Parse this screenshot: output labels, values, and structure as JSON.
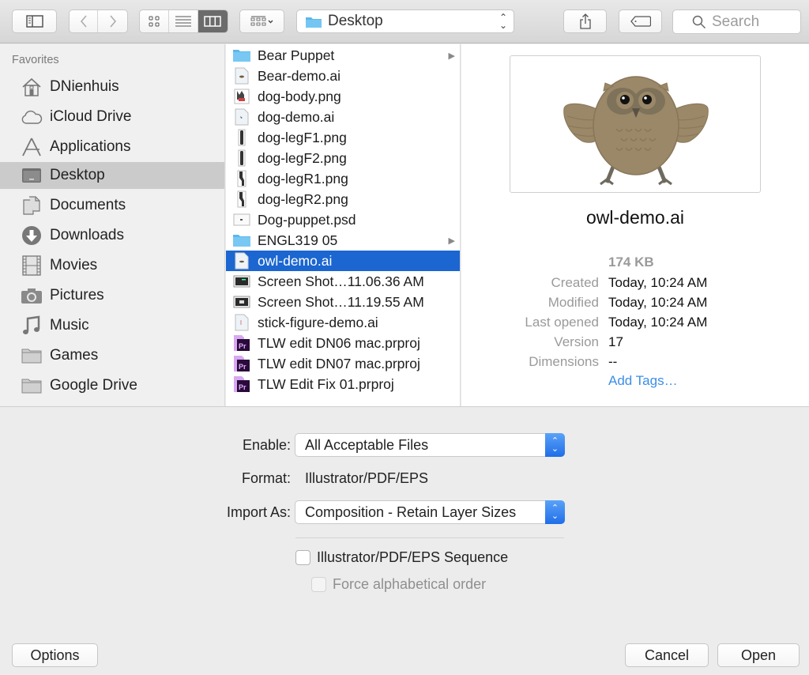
{
  "toolbar": {
    "sidebar_toggle_icon": "sidebar-icon",
    "back_icon": "chevron-left-icon",
    "forward_icon": "chevron-right-icon",
    "view_modes": [
      {
        "name": "icon-view",
        "icon": "grid-icon",
        "active": false
      },
      {
        "name": "list-view",
        "icon": "list-icon",
        "active": false
      },
      {
        "name": "column-view",
        "icon": "columns-icon",
        "active": true
      }
    ],
    "arrange_icon": "arrange-icon",
    "location": "Desktop",
    "share_icon": "share-icon",
    "tag_icon": "tag-icon",
    "search_placeholder": "Search"
  },
  "sidebar": {
    "heading": "Favorites",
    "items": [
      {
        "label": "DNienhuis",
        "icon": "home-icon",
        "selected": false
      },
      {
        "label": "iCloud Drive",
        "icon": "cloud-icon",
        "selected": false
      },
      {
        "label": "Applications",
        "icon": "applications-icon",
        "selected": false
      },
      {
        "label": "Desktop",
        "icon": "desktop-icon",
        "selected": true
      },
      {
        "label": "Documents",
        "icon": "documents-icon",
        "selected": false
      },
      {
        "label": "Downloads",
        "icon": "downloads-icon",
        "selected": false
      },
      {
        "label": "Movies",
        "icon": "film-icon",
        "selected": false
      },
      {
        "label": "Pictures",
        "icon": "camera-icon",
        "selected": false
      },
      {
        "label": "Music",
        "icon": "music-icon",
        "selected": false
      },
      {
        "label": "Games",
        "icon": "folder-icon",
        "selected": false
      },
      {
        "label": "Google Drive",
        "icon": "folder-icon",
        "selected": false
      }
    ]
  },
  "files": [
    {
      "name": "Bear Puppet",
      "type": "folder",
      "has_children": true
    },
    {
      "name": "Bear-demo.ai",
      "type": "ai"
    },
    {
      "name": "dog-body.png",
      "type": "png"
    },
    {
      "name": "dog-demo.ai",
      "type": "ai"
    },
    {
      "name": "dog-legF1.png",
      "type": "png-leg"
    },
    {
      "name": "dog-legF2.png",
      "type": "png-leg"
    },
    {
      "name": "dog-legR1.png",
      "type": "png-leg"
    },
    {
      "name": "dog-legR2.png",
      "type": "png-leg"
    },
    {
      "name": "Dog-puppet.psd",
      "type": "psd"
    },
    {
      "name": "ENGL319 05",
      "type": "folder",
      "has_children": true
    },
    {
      "name": "owl-demo.ai",
      "type": "ai",
      "selected": true
    },
    {
      "name": "Screen Shot…11.06.36 AM",
      "type": "screenshot"
    },
    {
      "name": "Screen Shot…11.19.55 AM",
      "type": "screenshot"
    },
    {
      "name": "stick-figure-demo.ai",
      "type": "ai"
    },
    {
      "name": "TLW edit DN06 mac.prproj",
      "type": "prproj"
    },
    {
      "name": "TLW edit DN07 mac.prproj",
      "type": "prproj"
    },
    {
      "name": "TLW Edit Fix 01.prproj",
      "type": "prproj"
    }
  ],
  "preview": {
    "filename": "owl-demo.ai",
    "size": "174 KB",
    "meta": [
      {
        "key": "Created",
        "value": "Today, 10:24 AM"
      },
      {
        "key": "Modified",
        "value": "Today, 10:24 AM"
      },
      {
        "key": "Last opened",
        "value": "Today, 10:24 AM"
      },
      {
        "key": "Version",
        "value": "17"
      },
      {
        "key": "Dimensions",
        "value": "--"
      }
    ],
    "add_tags": "Add Tags…"
  },
  "accessory": {
    "enable_label": "Enable:",
    "enable_value": "All Acceptable Files",
    "format_label": "Format:",
    "format_value": "Illustrator/PDF/EPS",
    "import_as_label": "Import As:",
    "import_as_value": "Composition - Retain Layer Sizes",
    "sequence_label": "Illustrator/PDF/EPS Sequence",
    "sequence_checked": false,
    "alpha_label": "Force alphabetical order",
    "alpha_checked": false,
    "alpha_enabled": false
  },
  "buttons": {
    "options": "Options",
    "cancel": "Cancel",
    "open": "Open"
  },
  "colors": {
    "selection": "#1b66d0",
    "link": "#3c8ee6",
    "stepper": "#2a78ee"
  }
}
